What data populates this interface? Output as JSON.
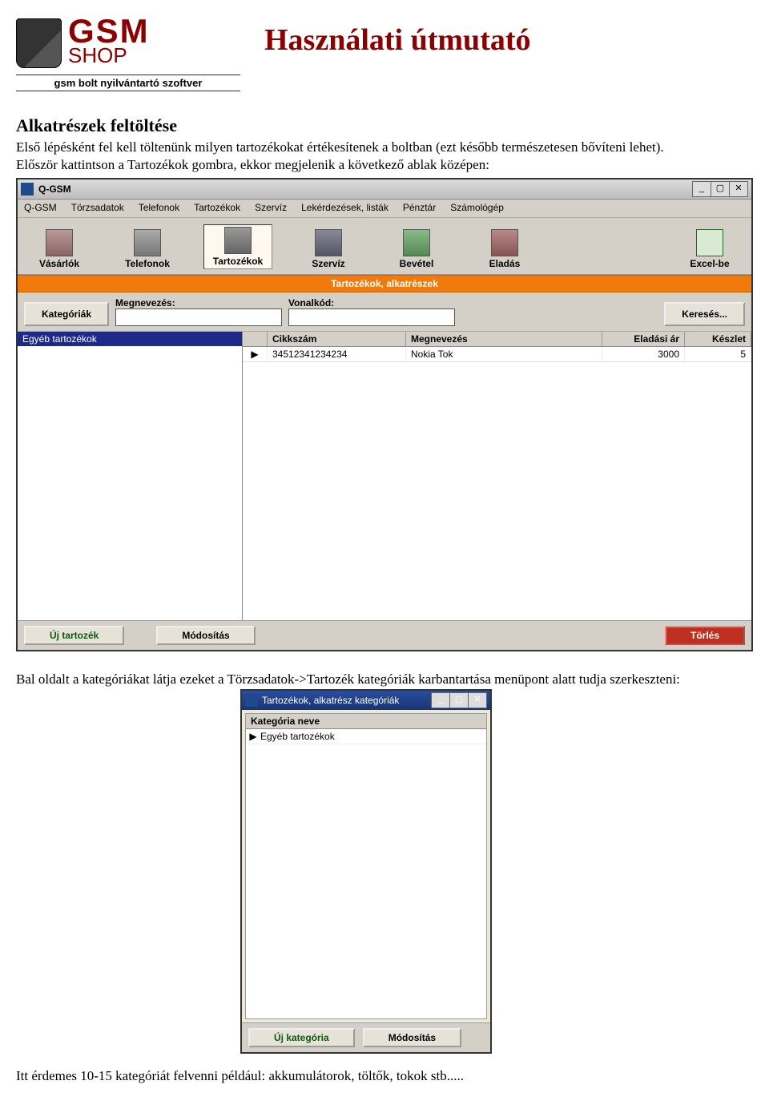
{
  "logo": {
    "main": "GSM",
    "sub": "SHOP",
    "subtitle": "gsm bolt nyilvántartó szoftver"
  },
  "page_title": "Használati útmutató",
  "intro": {
    "heading": "Alkatrészek feltöltése",
    "line1": "Első lépésként fel kell töltenünk milyen tartozékokat értékesítenek a boltban (ezt később természetesen bővíteni lehet).",
    "line2": "Először kattintson a Tartozékok gombra, ekkor megjelenik a következő ablak középen:"
  },
  "window1": {
    "title": "Q-GSM",
    "menu": [
      "Q-GSM",
      "Törzsadatok",
      "Telefonok",
      "Tartozékok",
      "Szervíz",
      "Lekérdezések, listák",
      "Pénztár",
      "Számológép"
    ],
    "tools": {
      "vasarlok": "Vásárlók",
      "telefonok": "Telefonok",
      "tartozekok": "Tartozékok",
      "szerviz": "Szervíz",
      "bevetel": "Bevétel",
      "eladas": "Eladás",
      "excel": "Excel-be"
    },
    "orange_header": "Tartozékok, alkatrészek",
    "buttons": {
      "kategoriak": "Kategóriák",
      "kereses": "Keresés..."
    },
    "search": {
      "megnevezes_label": "Megnevezés:",
      "vonalkod_label": "Vonalkód:"
    },
    "category_selected": "Egyéb tartozékok",
    "grid_headers": {
      "cikkszam": "Cikkszám",
      "megnevezes": "Megnevezés",
      "eladasiar": "Eladási ár",
      "keszlet": "Készlet"
    },
    "grid_row": {
      "marker": "▶",
      "cikkszam": "34512341234234",
      "megnevezes": "Nokia Tok",
      "eladasiar": "3000",
      "keszlet": "5"
    },
    "bottom": {
      "uj": "Új tartozék",
      "modositas": "Módosítás",
      "torles": "Törlés"
    }
  },
  "mid_text": "Bal oldalt a kategóriákat látja ezeket a Törzsadatok->Tartozék kategóriák karbantartása menüpont alatt tudja szerkeszteni:",
  "window2": {
    "title": "Tartozékok, alkatrész kategóriák",
    "header": "Kategória neve",
    "row_marker": "▶",
    "row_value": "Egyéb tartozékok",
    "bottom": {
      "uj": "Új kategória",
      "modositas": "Módosítás"
    }
  },
  "footer": "Itt érdemes 10-15 kategóriát felvenni például: akkumulátorok, töltők, tokok stb....."
}
